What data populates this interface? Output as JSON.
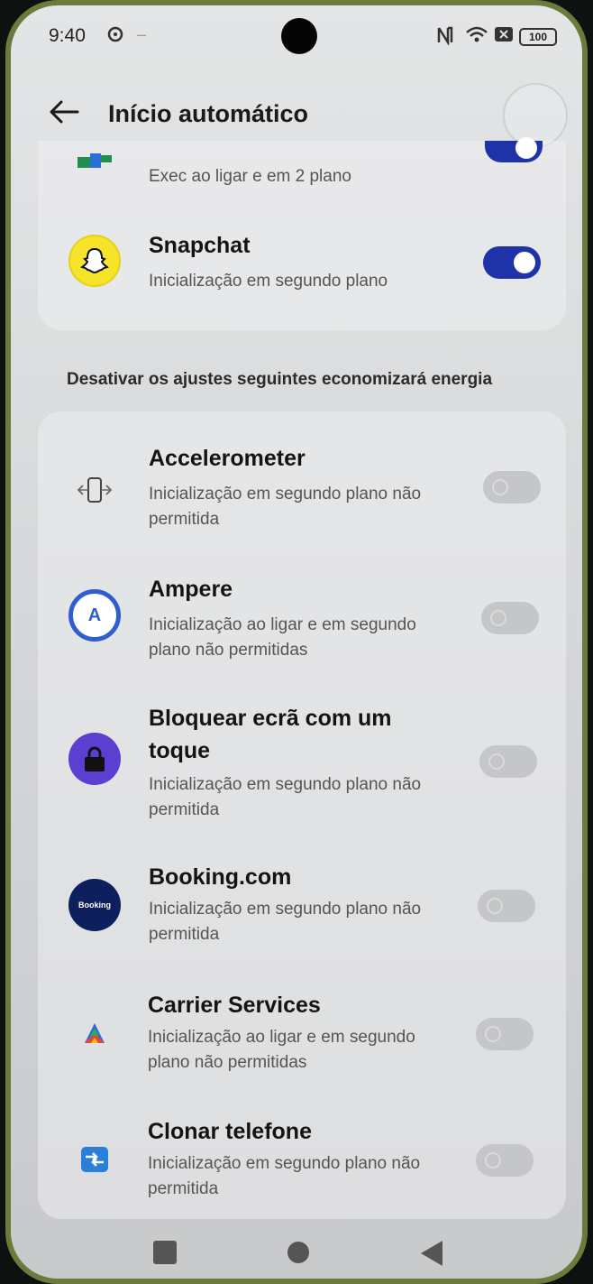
{
  "status_bar": {
    "time": "9:40",
    "battery": "100",
    "icons": [
      "settings-cog-icon",
      "nfc-icon",
      "wifi-icon",
      "sim-icon",
      "battery-icon"
    ]
  },
  "header": {
    "title": "Início automático"
  },
  "top_list": [
    {
      "desc": "Exec ao ligar e em 2 plano",
      "toggle_on": true,
      "icon": "maps-icon"
    },
    {
      "name": "Snapchat",
      "desc": "Inicialização em segundo plano",
      "toggle_on": true,
      "icon": "snapchat-ghost-icon"
    }
  ],
  "section_caption": "Desativar os ajustes seguintes economizará energia",
  "apps": [
    {
      "name": "Accelerometer",
      "desc": "Inicialização em segundo plano não permitida",
      "toggle_on": false,
      "icon": "phone-rotate-icon"
    },
    {
      "name": "Ampere",
      "desc": "Inicialização ao ligar e em segundo plano não permitidas",
      "toggle_on": false,
      "icon": "ampere-icon",
      "icon_letter": "A"
    },
    {
      "name": "Bloquear ecrã com um toque",
      "desc": "Inicialização em segundo plano não permitida",
      "toggle_on": false,
      "icon": "lock-icon"
    },
    {
      "name": "Booking.com",
      "desc": "Inicialização em segundo plano não permitida",
      "toggle_on": false,
      "icon": "booking-icon",
      "icon_text": "Booking"
    },
    {
      "name": "Carrier Services",
      "desc": "Inicialização ao ligar e em segundo plano não permitidas",
      "toggle_on": false,
      "icon": "puzzle-icon"
    },
    {
      "name": "Clonar telefone",
      "desc": "Inicialização em segundo plano não permitida",
      "toggle_on": false,
      "icon": "clone-arrows-icon"
    }
  ],
  "colors": {
    "toggle_on": "#1f33a8",
    "toggle_off": "#c5c6c8",
    "snapchat_yellow": "#f5e42a",
    "ampere_blue": "#2f5fcf",
    "lock_purple": "#5a3fd1",
    "booking_navy": "#0d1f5c"
  }
}
